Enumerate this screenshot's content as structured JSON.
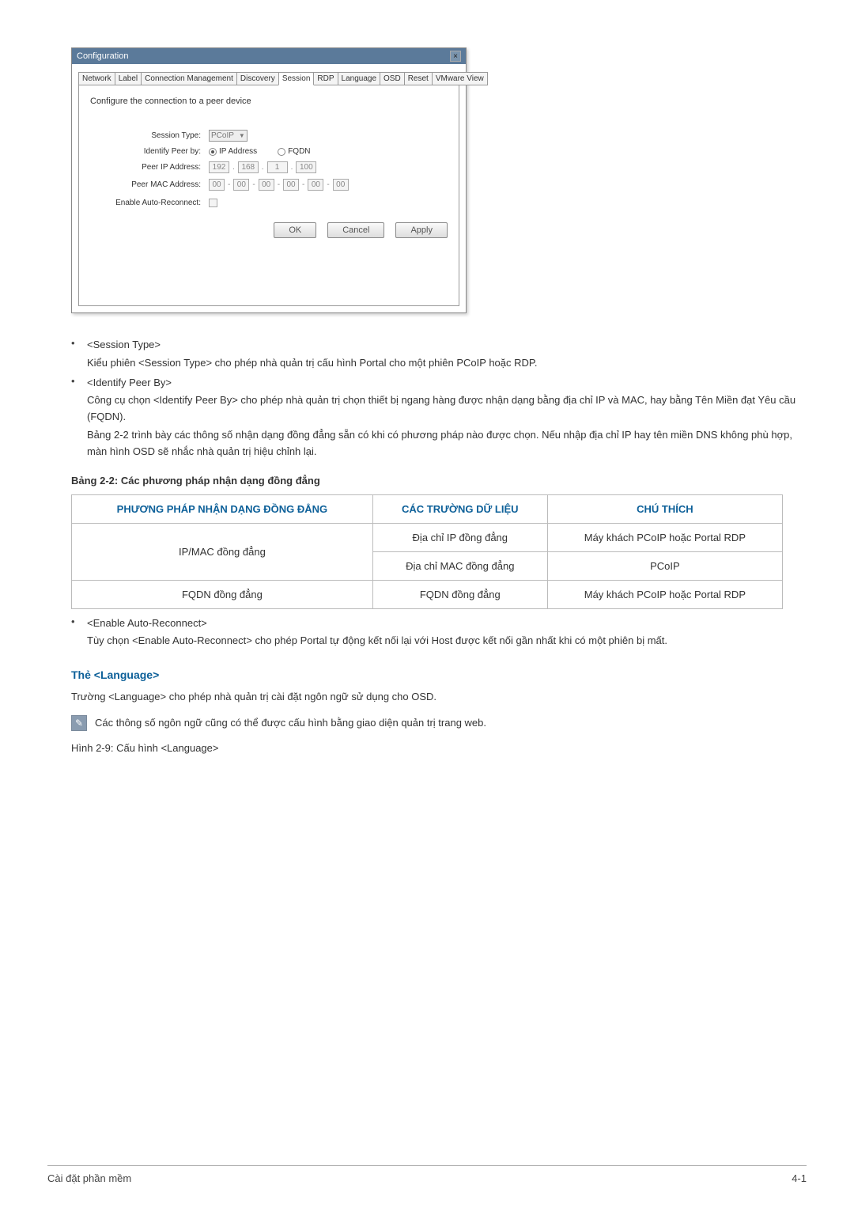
{
  "dialog": {
    "title": "Configuration",
    "tabs": [
      "Network",
      "Label",
      "Connection Management",
      "Discovery",
      "Session",
      "RDP",
      "Language",
      "OSD",
      "Reset",
      "VMware View"
    ],
    "active_tab": "Session",
    "description": "Configure the connection to a peer device",
    "fields": {
      "session_type": {
        "label": "Session Type:",
        "value": "PCoIP"
      },
      "identify_peer_by": {
        "label": "Identify Peer by:",
        "opt1": "IP Address",
        "opt2": "FQDN"
      },
      "peer_ip": {
        "label": "Peer IP Address:",
        "octets": [
          "192",
          "168",
          "1",
          "100"
        ]
      },
      "peer_mac": {
        "label": "Peer MAC Address:",
        "octets": [
          "00",
          "00",
          "00",
          "00",
          "00",
          "00"
        ]
      },
      "auto_reconnect": {
        "label": "Enable Auto-Reconnect:"
      }
    },
    "buttons": {
      "ok": "OK",
      "cancel": "Cancel",
      "apply": "Apply"
    }
  },
  "bullets1": [
    {
      "title": "<Session Type>",
      "desc": "Kiểu phiên <Session Type> cho phép nhà quản trị cấu hình Portal cho một phiên PCoIP hoặc RDP."
    },
    {
      "title": "<Identify Peer By>",
      "desc": "Công cụ chọn <Identify Peer By> cho phép nhà quản trị chọn thiết bị ngang hàng được nhận dạng bằng địa chỉ IP và MAC, hay bằng Tên Miền đạt Yêu cầu (FQDN).",
      "desc2": "Bảng 2-2 trình bày các thông số nhận dạng đồng đẳng sẵn có khi có phương pháp nào được chọn. Nếu nhập địa chỉ IP hay tên miền DNS không phù hợp, màn hình OSD sẽ nhắc nhà quản trị hiệu chỉnh lại."
    }
  ],
  "table_caption": "Bảng 2-2: Các phương pháp nhận dạng đồng đẳng",
  "table": {
    "headers": [
      "PHƯƠNG PHÁP NHẬN DẠNG ĐỒNG ĐẲNG",
      "CÁC TRƯỜNG DỮ LIỆU",
      "CHÚ THÍCH"
    ],
    "rows": [
      [
        "IP/MAC đồng đẳng",
        "Địa chỉ IP đồng đẳng",
        "Máy khách PCoIP hoặc Portal RDP"
      ],
      [
        "",
        "Địa chỉ MAC đồng đẳng",
        "PCoIP"
      ],
      [
        "FQDN đồng đẳng",
        "FQDN đồng đẳng",
        "Máy khách PCoIP hoặc Portal RDP"
      ]
    ]
  },
  "bullets2": [
    {
      "title": "<Enable Auto-Reconnect>",
      "desc": "Tùy chọn <Enable Auto-Reconnect> cho phép Portal tự động kết nối lại với Host được kết nối gần nhất khi có một phiên bị mất."
    }
  ],
  "section": {
    "heading": "Thẻ <Language>",
    "para": "Trường <Language> cho phép nhà quản trị cài đặt ngôn ngữ sử dụng cho OSD.",
    "note": "Các thông số ngôn ngữ cũng có thể được cấu hình bằng giao diện quản trị trang web.",
    "figure": "Hình 2-9: Cấu hình <Language>"
  },
  "footer": {
    "left": "Cài đặt phần mềm",
    "right": "4-1"
  }
}
